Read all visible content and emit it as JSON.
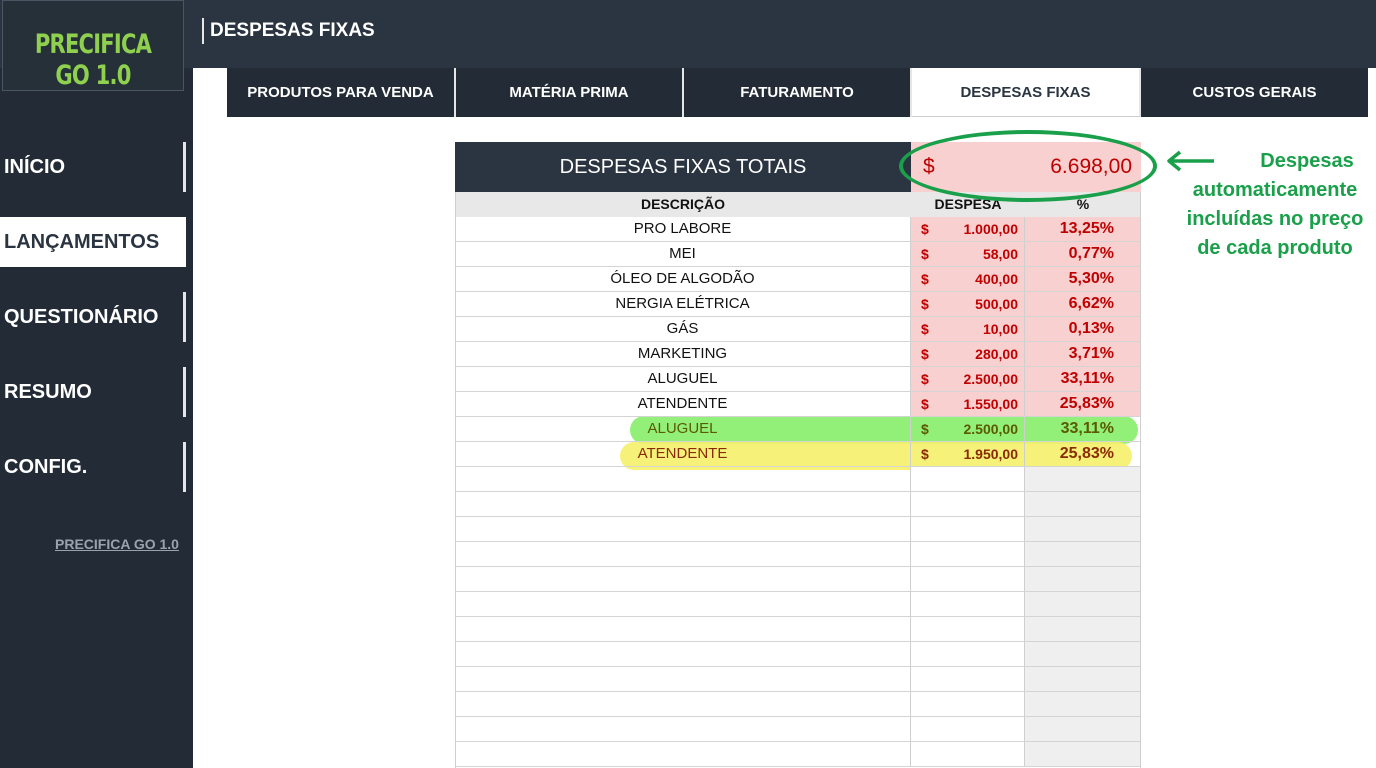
{
  "app": {
    "logo": "PRECIFICA GO 1.0",
    "page_title": "DESPESAS FIXAS"
  },
  "sidebar": {
    "items": [
      {
        "label": "INÍCIO",
        "active": false
      },
      {
        "label": "LANÇAMENTOS",
        "active": true
      },
      {
        "label": "QUESTIONÁRIO",
        "active": false
      },
      {
        "label": "RESUMO",
        "active": false
      },
      {
        "label": "CONFIG.",
        "active": false
      }
    ],
    "footer_link": "PRECIFICA GO 1.0"
  },
  "tabs": [
    {
      "label": "PRODUTOS PARA VENDA",
      "active": false
    },
    {
      "label": "MATÉRIA PRIMA",
      "active": false
    },
    {
      "label": "FATURAMENTO",
      "active": false
    },
    {
      "label": "DESPESAS FIXAS",
      "active": true
    },
    {
      "label": "CUSTOS GERAIS",
      "active": false
    }
  ],
  "summary": {
    "label": "DESPESAS FIXAS TOTAIS",
    "currency": "$",
    "total": "6.698,00"
  },
  "table": {
    "headers": {
      "description": "DESCRIÇÃO",
      "expense": "DESPESA",
      "percent": "%"
    },
    "rows": [
      {
        "description": "PRO LABORE",
        "currency": "$",
        "expense": "1.000,00",
        "percent": "13,25%"
      },
      {
        "description": "MEI",
        "currency": "$",
        "expense": "58,00",
        "percent": "0,77%"
      },
      {
        "description": "ÓLEO DE ALGODÃO",
        "currency": "$",
        "expense": "400,00",
        "percent": "5,30%"
      },
      {
        "description": "NERGIA ELÉTRICA",
        "currency": "$",
        "expense": "500,00",
        "percent": "6,62%"
      },
      {
        "description": "GÁS",
        "currency": "$",
        "expense": "10,00",
        "percent": "0,13%"
      },
      {
        "description": "MARKETING",
        "currency": "$",
        "expense": "280,00",
        "percent": "3,71%"
      },
      {
        "description": "ALUGUEL",
        "currency": "$",
        "expense": "2.500,00",
        "percent": "33,11%"
      },
      {
        "description": "ATENDENTE",
        "currency": "$",
        "expense": "1.550,00",
        "percent": "25,83%"
      },
      {
        "description": "ALUGUEL",
        "currency": "$",
        "expense": "2.500,00",
        "percent": "33,11%",
        "highlight": "green"
      },
      {
        "description": "ATENDENTE",
        "currency": "$",
        "expense": "1.950,00",
        "percent": "25,83%",
        "highlight": "yellow"
      }
    ]
  },
  "annotation": {
    "lines": [
      "Despesas",
      "automaticamente",
      "incluídas no preço",
      "de cada produto"
    ],
    "color": "#1aa04a"
  },
  "colors": {
    "dark": "#2b3541",
    "negative": "#c00000",
    "cell_fill": "#f8d0d0",
    "logo_green": "#8fd14f"
  }
}
